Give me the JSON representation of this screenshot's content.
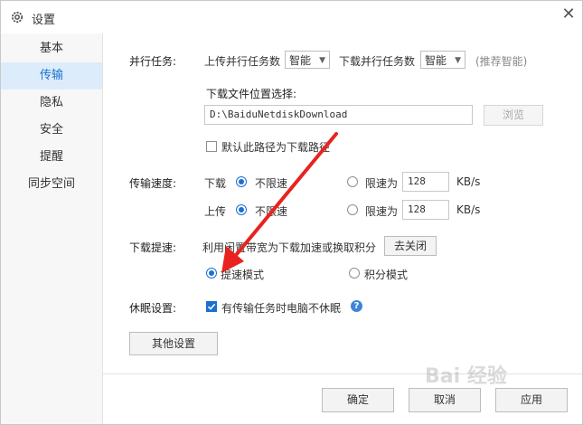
{
  "window": {
    "title": "设置"
  },
  "sidebar": {
    "items": [
      {
        "label": "基本"
      },
      {
        "label": "传输",
        "active": true
      },
      {
        "label": "隐私"
      },
      {
        "label": "安全"
      },
      {
        "label": "提醒"
      },
      {
        "label": "同步空间"
      }
    ]
  },
  "parallel": {
    "title": "并行任务:",
    "upload_label": "上传并行任务数",
    "upload_value": "智能",
    "download_label": "下载并行任务数",
    "download_value": "智能",
    "hint": "(推荐智能)"
  },
  "download_location": {
    "title": "下载文件位置选择:",
    "path": "D:\\BaiduNetdiskDownload",
    "browse_label": "浏览",
    "default_checkbox_label": "默认此路径为下载路径",
    "default_checked": false
  },
  "speed": {
    "title": "传输速度:",
    "download_label": "下载",
    "upload_label": "上传",
    "unlimited_label": "不限速",
    "limited_label": "限速为",
    "download_limit_value": "128",
    "upload_limit_value": "128",
    "unit": "KB/s",
    "download_unlimited": true,
    "upload_unlimited": true
  },
  "accelerate": {
    "title": "下载提速:",
    "description": "利用闲置带宽为下载加速或换取积分",
    "close_button": "去关闭",
    "speed_mode_label": "提速模式",
    "points_mode_label": "积分模式",
    "mode": "speed"
  },
  "sleep": {
    "title": "休眠设置:",
    "checkbox_label": "有传输任务时电脑不休眠",
    "checked": true
  },
  "other_settings_button": "其他设置",
  "footer": {
    "ok": "确定",
    "cancel": "取消",
    "apply": "应用"
  },
  "colors": {
    "accent": "#1b6fd0",
    "annotation_arrow": "#e8231f"
  }
}
